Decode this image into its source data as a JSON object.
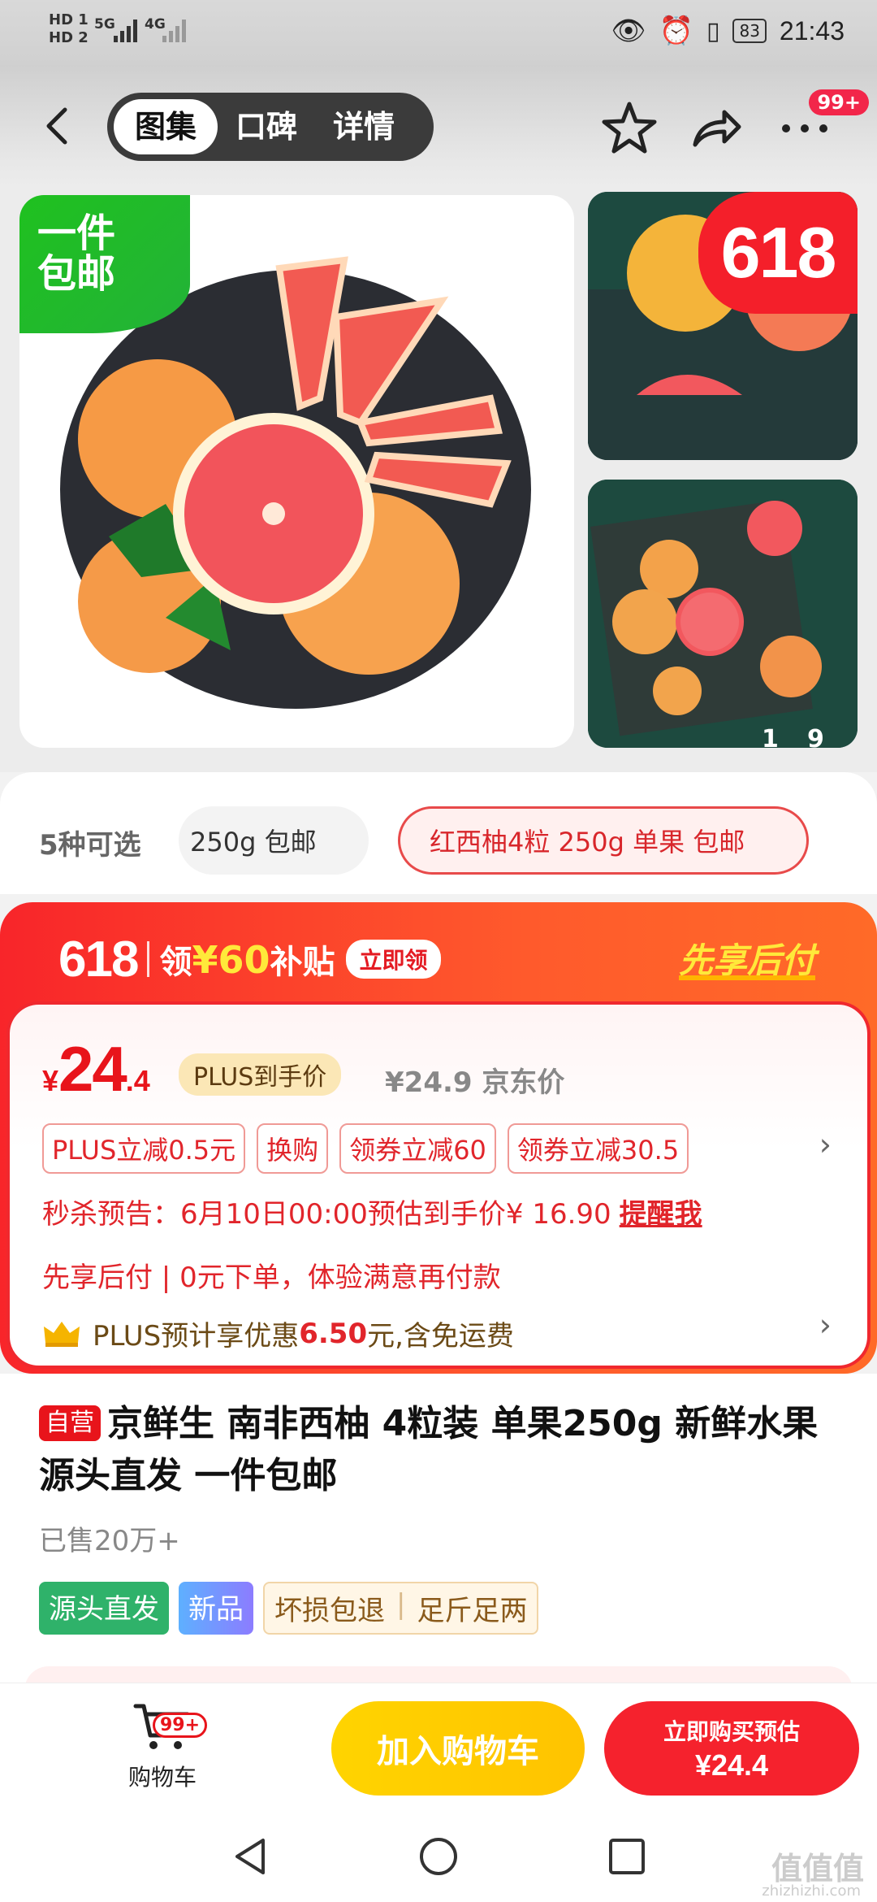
{
  "status": {
    "hd1": "HD 1",
    "hd2": "HD 2",
    "net1": "5G",
    "net2": "4G",
    "battery": "83",
    "time": "21:43"
  },
  "nav": {
    "tabs": [
      "图集",
      "口碑",
      "详情"
    ],
    "more_badge": "99+"
  },
  "gallery": {
    "ship_tag_line1": "一件",
    "ship_tag_line2": "包邮",
    "badge_618": "618",
    "page_current": "1",
    "page_total": "9"
  },
  "spec": {
    "count_label": "5种可选",
    "option_partial": "250g 包邮",
    "option_selected": "红西柚4粒 250g 单果 包邮"
  },
  "promo": {
    "event": "618",
    "subsidy_prefix": "领",
    "subsidy_amount": "¥60",
    "subsidy_suffix": "补贴",
    "claim_btn": "立即领",
    "pay_later_title": "先享后付",
    "price_currency": "¥",
    "price_int": "24",
    "price_dec": ".4",
    "plus_tag": "PLUS到手价",
    "jd_price": "¥24.9 京东价",
    "coupons": [
      "PLUS立减0.5元",
      "换购",
      "领券立减60",
      "领券立减30.5"
    ],
    "seckill_text": "秒杀预告：6月10日00:00预估到手价¥ 16.90",
    "seckill_remind": "提醒我",
    "pay_later_line": "先享后付 | 0元下单，体验满意再付款",
    "plus_line_prefix": "PLUS预计享优惠",
    "plus_line_amount": "6.50",
    "plus_line_suffix": "元,含免运费"
  },
  "product": {
    "self_tag": "自营",
    "title": "京鲜生 南非西柚 4粒装 单果250g 新鲜水果 源头直发 一件包邮",
    "sold": "已售20万+",
    "tag_source": "源头直发",
    "tag_new": "新品",
    "tag_guarantee1": "坏损包退",
    "tag_guarantee2": "足斤足两"
  },
  "bottom": {
    "cart_badge": "99+",
    "cart_label": "购物车",
    "add_cart": "加入购物车",
    "buy_line1": "立即购买预估",
    "buy_line2": "¥24.4"
  },
  "watermark": {
    "main": "值值值",
    "sub": "zhizhizhi.com"
  },
  "colors": {
    "accent": "#e8141b",
    "promo_yellow": "#ffe93a",
    "green": "#2fb26a",
    "add_cart": "#ffc300"
  }
}
